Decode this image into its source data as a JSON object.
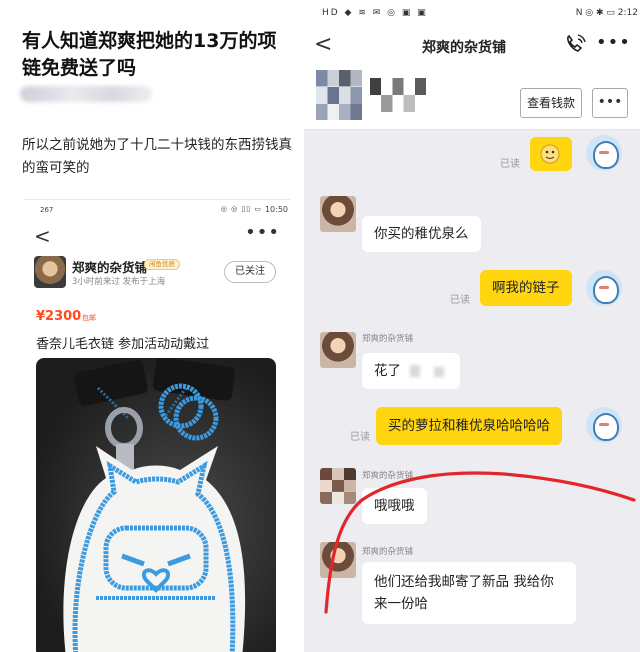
{
  "left": {
    "headline": "有人知道郑爽把她的13万的项链免费送了吗",
    "body": "所以之前说她为了十几二十块钱的东西捞钱真的蛮可笑的",
    "inner": {
      "status_left": "267",
      "status_icons": "◎ ◎ ▯▯ ▭",
      "clock": "10:50",
      "back_icon": "<",
      "more_icon": "•••",
      "shop_name": "郑爽的杂货铺",
      "shop_badge": "闲鱼优质",
      "shop_sub": "3小时前来过 发布于上海",
      "follow": "已关注",
      "price": "¥2300",
      "price_tag": "包邮",
      "item_title": "香奈儿毛衣链 参加活动动戴过"
    }
  },
  "right": {
    "status_left": "HD ◆ ≋ ✉ ◎ ▣ ▣",
    "status_right": "N ◎ ✱ ▭ 2:12",
    "back_icon": "<",
    "title": "郑爽的杂货铺",
    "more_icon": "•••",
    "btn_money": "查看钱款",
    "btn_dots": "•••",
    "read_label": "已读",
    "shop_sender": "郑爽的杂货铺",
    "messages": [
      {
        "side": "in",
        "text": "你买的稚优泉么"
      },
      {
        "side": "out",
        "text": "啊我的链子"
      },
      {
        "side": "in",
        "text": "花了"
      },
      {
        "side": "out",
        "text": "买的萝拉和稚优泉哈哈哈哈"
      },
      {
        "side": "in",
        "text": "哦哦哦"
      },
      {
        "side": "in",
        "text": "他们还给我邮寄了新品 我给你"
      },
      {
        "side": "in",
        "text": "来一份哈"
      }
    ],
    "colors": {
      "accent_bubble": "#ffd50f",
      "annotation": "#e3262a"
    }
  }
}
